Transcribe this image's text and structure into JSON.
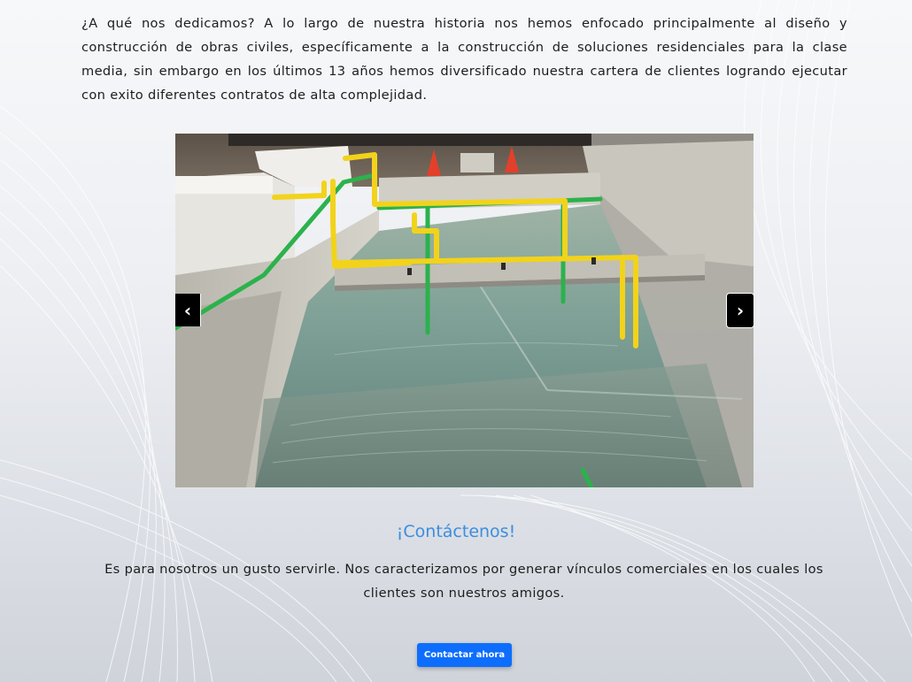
{
  "intro": {
    "text": "¿A qué nos dedicamos? A lo largo de nuestra historia nos hemos enfocado principalmente al diseño y construcción de obras civiles, específicamente a la construcción de soluciones residenciales para la clase media, sin embargo en los últimos 13 años hemos diversificado nuestra cartera de clientes logrando ejecutar con exito diferentes contratos de alta complejidad."
  },
  "carousel": {
    "prev_label": "‹",
    "next_label": "›",
    "prev_icon": "chevron-left-icon",
    "next_icon": "chevron-right-icon"
  },
  "contact": {
    "title": "¡Contáctenos!",
    "text": "Es para nosotros un gusto servirle. Nos caracterizamos por generar vínculos comerciales en los cuales los clientes son nuestros amigos.",
    "button_label": "Contactar ahora"
  },
  "colors": {
    "accent": "#3b8ee0",
    "button": "#0d6efd",
    "pipe_yellow": "#f2d31b",
    "pipe_green": "#2bb24c"
  }
}
